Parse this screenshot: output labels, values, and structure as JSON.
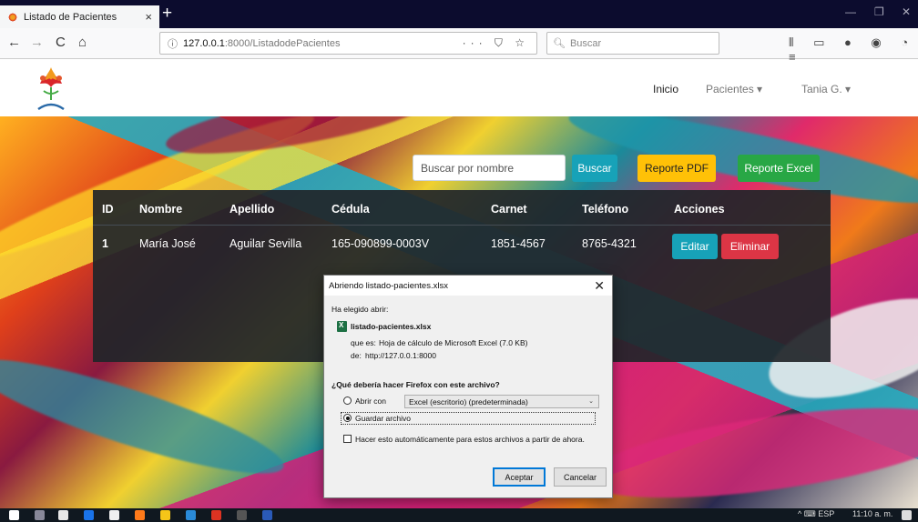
{
  "browser": {
    "tab_title": "Listado de Pacientes",
    "tab_close": "×",
    "new_tab": "+",
    "url_host": "127.0.0.1",
    "url_path": ":8000/ListadodePacientes",
    "url_icons": "··· ⛉ ☆",
    "search_placeholder": "Buscar",
    "nav_back": "←",
    "nav_forward": "→",
    "nav_reload": "C",
    "nav_home": "⌂",
    "toolbar_icons": "⫴ ▭ ● ◉ ◔ ≡",
    "win_minimize": "—",
    "win_restore": "❐",
    "win_close": "✕"
  },
  "site": {
    "nav": {
      "home": "Inicio",
      "patients": "Pacientes ▾",
      "user": "Tania G. ▾"
    },
    "search": {
      "placeholder": "Buscar por nombre",
      "button": "Buscar"
    },
    "reports": {
      "pdf": "Reporte PDF",
      "excel": "Reporte Excel"
    },
    "table": {
      "headers": [
        "ID",
        "Nombre",
        "Apellido",
        "Cédula",
        "Carnet",
        "Teléfono",
        "Acciones"
      ],
      "rows": [
        {
          "id": "1",
          "nombre": "María José",
          "apellido": "Aguilar Sevilla",
          "cedula": "165-090899-0003V",
          "carnet": "1851-4567",
          "telefono": "8765-4321",
          "edit": "Editar",
          "delete": "Eliminar"
        }
      ]
    }
  },
  "dialog": {
    "title": "Abriendo listado-pacientes.xlsx",
    "close": "✕",
    "chosen_label": "Ha elegido abrir:",
    "filename": "listado-pacientes.xlsx",
    "type_label": "que es:",
    "type_value": "Hoja de cálculo de Microsoft Excel (7.0 KB)",
    "from_label": "de:",
    "from_value": "http://127.0.0.1:8000",
    "question": "¿Qué debería hacer Firefox con este archivo?",
    "open_with_label": "Abrir con",
    "open_with_value": "Excel (escritorio) (predeterminada)",
    "select_arrow": "⌄",
    "save_label": "Guardar archivo",
    "auto_label": "Hacer esto automáticamente para estos archivos a partir de ahora.",
    "accept": "Aceptar",
    "cancel": "Cancelar"
  },
  "taskbar": {
    "tray_text": "^ ⌨ ESP",
    "clock": "11:10 a. m."
  },
  "colors": {
    "info": "#17a2b8",
    "warning": "#ffc107",
    "success": "#28a745",
    "danger": "#dc3545",
    "table_bg": "#212529"
  }
}
